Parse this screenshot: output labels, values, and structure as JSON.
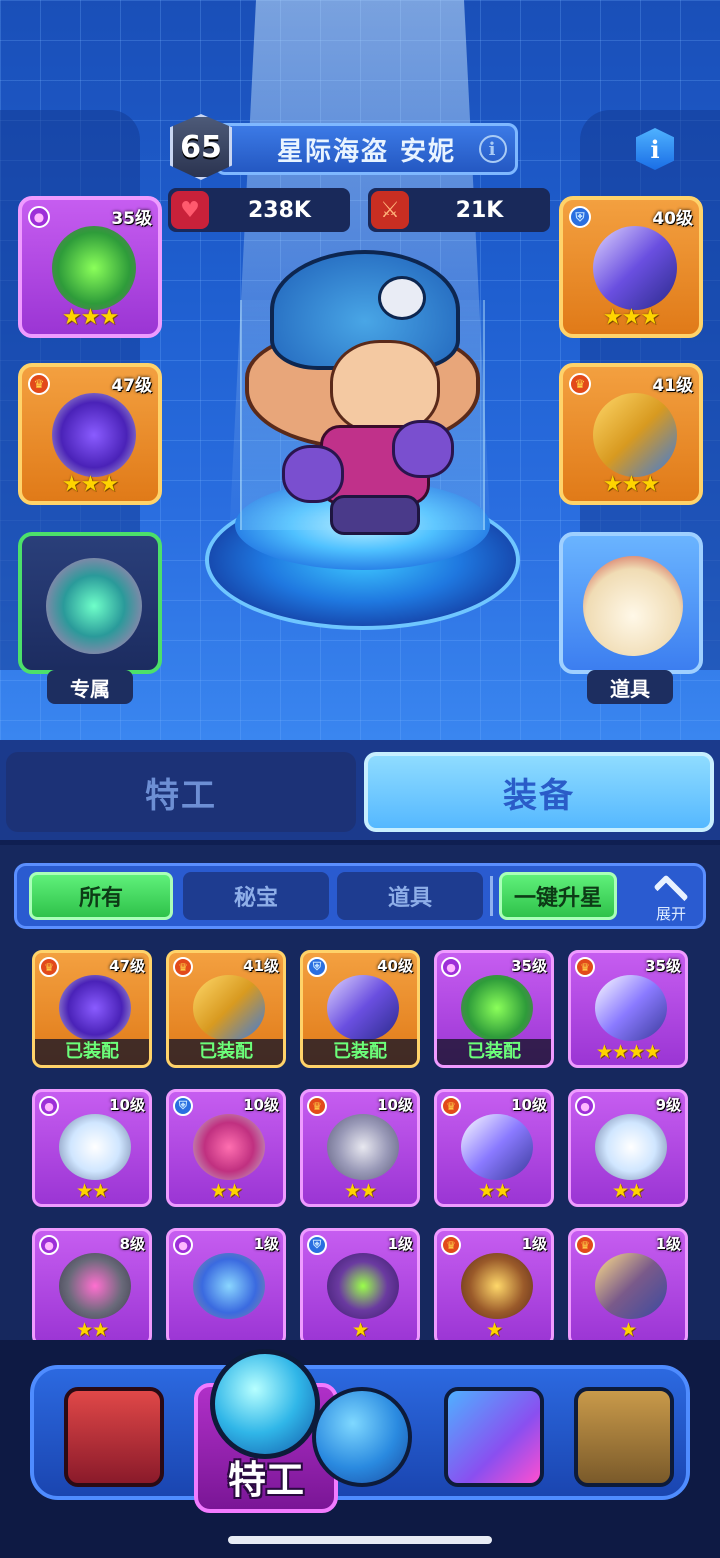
{
  "hero": {
    "level": "65",
    "name": "星际海盗 安妮",
    "hp": "238K",
    "attack": "21K"
  },
  "slots": {
    "left": [
      {
        "level": "35级",
        "stars": "★★★",
        "frame": "purple"
      },
      {
        "level": "47级",
        "stars": "★★★",
        "frame": "orange"
      },
      {
        "tag": "专属",
        "frame": "green"
      }
    ],
    "right": [
      {
        "level": "40级",
        "stars": "★★★",
        "frame": "orange"
      },
      {
        "level": "41级",
        "stars": "★★★",
        "frame": "orange"
      },
      {
        "tag": "道具",
        "frame": "blue"
      }
    ]
  },
  "main_tabs": {
    "agent": "特工",
    "equipment": "装备"
  },
  "filters": {
    "all": "所有",
    "secret": "秘宝",
    "item": "道具",
    "star_up": "一键升星",
    "expand": "展开"
  },
  "inventory": [
    {
      "level": "47级",
      "frame": "orange",
      "rarity": "crown",
      "status": "已装配",
      "stars": ""
    },
    {
      "level": "41级",
      "frame": "orange",
      "rarity": "crown",
      "status": "已装配",
      "stars": ""
    },
    {
      "level": "40级",
      "frame": "orange",
      "rarity": "shield",
      "status": "已装配",
      "stars": ""
    },
    {
      "level": "35级",
      "frame": "purple",
      "rarity": "orb",
      "status": "已装配",
      "stars": ""
    },
    {
      "level": "35级",
      "frame": "purple",
      "rarity": "crown",
      "status": "",
      "stars": "★★★★"
    },
    {
      "level": "10级",
      "frame": "purple",
      "rarity": "orb",
      "status": "",
      "stars": "★★"
    },
    {
      "level": "10级",
      "frame": "purple",
      "rarity": "shield",
      "status": "",
      "stars": "★★"
    },
    {
      "level": "10级",
      "frame": "purple",
      "rarity": "crown",
      "status": "",
      "stars": "★★"
    },
    {
      "level": "10级",
      "frame": "purple",
      "rarity": "crown",
      "status": "",
      "stars": "★★"
    },
    {
      "level": "9级",
      "frame": "purple",
      "rarity": "orb",
      "status": "",
      "stars": "★★"
    },
    {
      "level": "8级",
      "frame": "purple",
      "rarity": "orb",
      "status": "",
      "stars": "★★"
    },
    {
      "level": "1级",
      "frame": "purple",
      "rarity": "orb",
      "status": "",
      "stars": ""
    },
    {
      "level": "1级",
      "frame": "purple",
      "rarity": "shield",
      "status": "",
      "stars": "★"
    },
    {
      "level": "1级",
      "frame": "purple",
      "rarity": "crown",
      "status": "",
      "stars": "★"
    },
    {
      "level": "1级",
      "frame": "purple",
      "rarity": "crown",
      "status": "",
      "stars": "★"
    }
  ],
  "bottom_nav": {
    "active_label": "特工",
    "icons": [
      "shop-machine-icon",
      "agent-icon",
      "planet-icon",
      "cube-icon",
      "portal-icon"
    ]
  },
  "colors": {
    "gold_star": "#ffd400",
    "equipped_text": "#6cff7a",
    "active_filter": "#2fc24a"
  }
}
